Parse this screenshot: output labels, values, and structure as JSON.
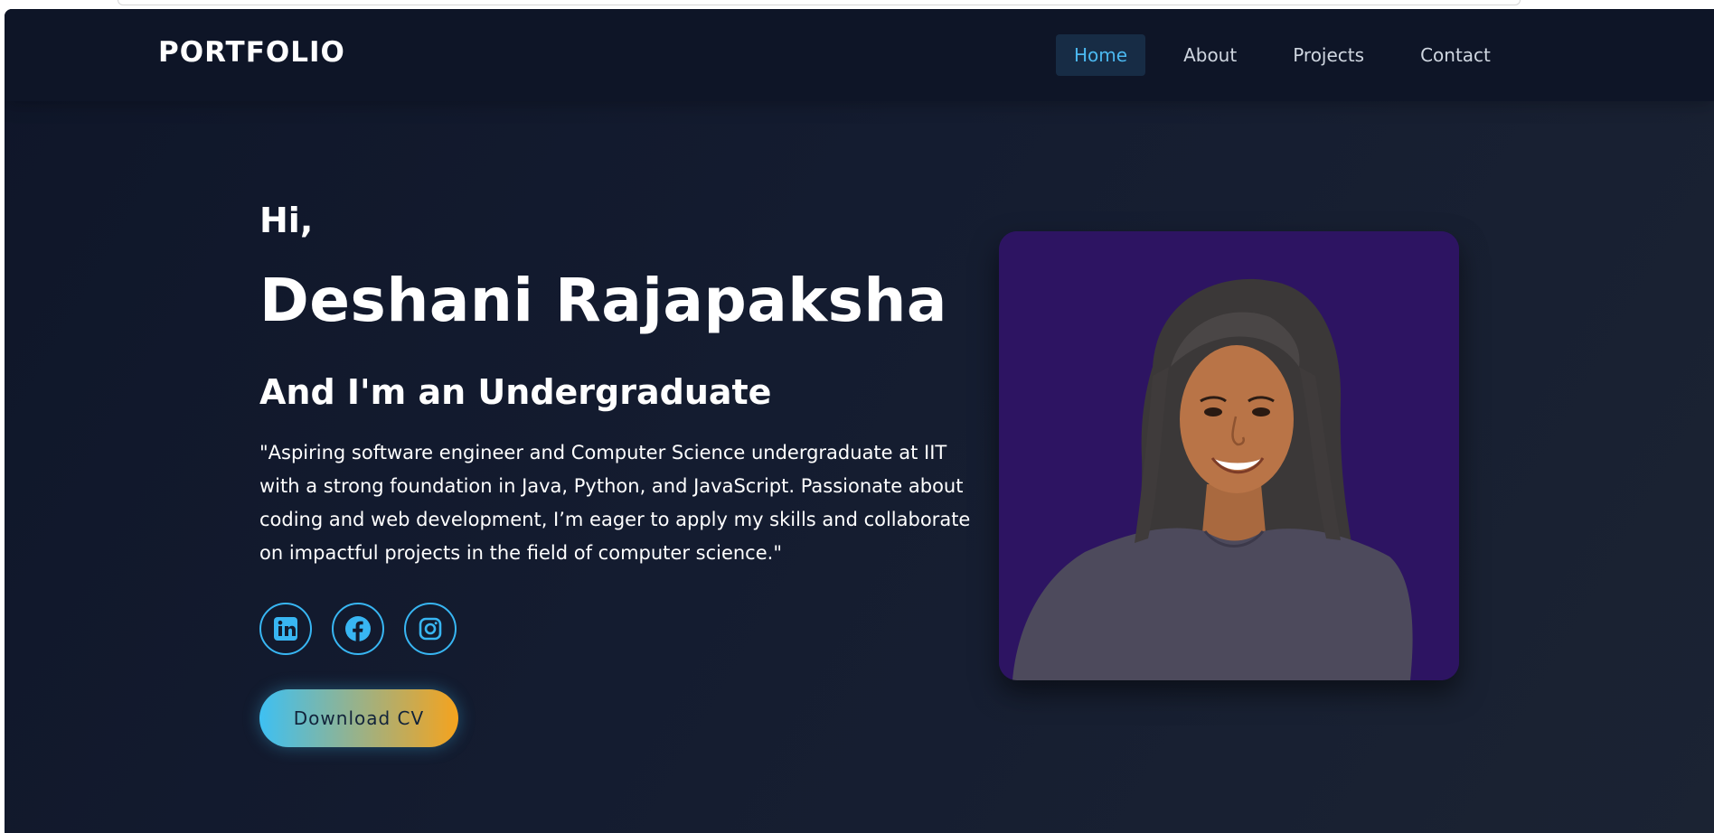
{
  "navbar": {
    "logo": "PORTFOLIO",
    "links": [
      {
        "label": "Home",
        "active": true
      },
      {
        "label": "About",
        "active": false
      },
      {
        "label": "Projects",
        "active": false
      },
      {
        "label": "Contact",
        "active": false
      }
    ]
  },
  "hero": {
    "greeting": "Hi,",
    "name": "Deshani Rajapaksha",
    "role": "And I'm an Undergraduate",
    "bio": "\"Aspiring software engineer and Computer Science undergraduate at IIT with a strong foundation in Java, Python, and JavaScript. Passionate about coding and web development, I’m eager to apply my skills and collaborate on impactful projects in the field of computer science.\"",
    "socials": [
      {
        "icon": "linkedin-icon"
      },
      {
        "icon": "facebook-icon"
      },
      {
        "icon": "instagram-icon"
      }
    ],
    "cv_button": "Download CV",
    "photo": {
      "icon": "profile-photo",
      "background": "#2d1462"
    }
  },
  "colors": {
    "accent": "#38b6f3",
    "nav_active": "#4bb8f0",
    "gradient_start": "#3ec0f2",
    "gradient_end": "#f5a31e",
    "background": "#111a2d"
  }
}
